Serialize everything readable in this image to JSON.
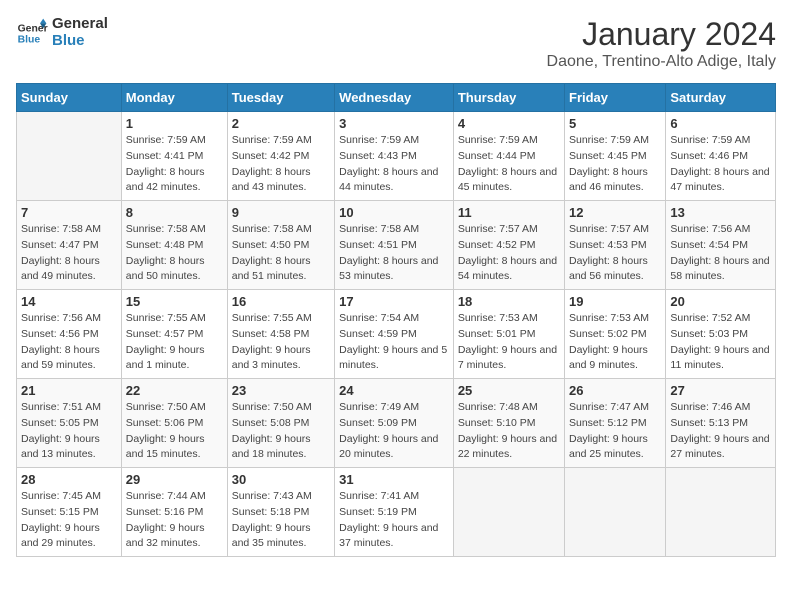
{
  "header": {
    "logo_line1": "General",
    "logo_line2": "Blue",
    "title": "January 2024",
    "subtitle": "Daone, Trentino-Alto Adige, Italy"
  },
  "days_of_week": [
    "Sunday",
    "Monday",
    "Tuesday",
    "Wednesday",
    "Thursday",
    "Friday",
    "Saturday"
  ],
  "weeks": [
    [
      {
        "day": "",
        "sunrise": "",
        "sunset": "",
        "daylight": ""
      },
      {
        "day": "1",
        "sunrise": "7:59 AM",
        "sunset": "4:41 PM",
        "daylight": "8 hours and 42 minutes."
      },
      {
        "day": "2",
        "sunrise": "7:59 AM",
        "sunset": "4:42 PM",
        "daylight": "8 hours and 43 minutes."
      },
      {
        "day": "3",
        "sunrise": "7:59 AM",
        "sunset": "4:43 PM",
        "daylight": "8 hours and 44 minutes."
      },
      {
        "day": "4",
        "sunrise": "7:59 AM",
        "sunset": "4:44 PM",
        "daylight": "8 hours and 45 minutes."
      },
      {
        "day": "5",
        "sunrise": "7:59 AM",
        "sunset": "4:45 PM",
        "daylight": "8 hours and 46 minutes."
      },
      {
        "day": "6",
        "sunrise": "7:59 AM",
        "sunset": "4:46 PM",
        "daylight": "8 hours and 47 minutes."
      }
    ],
    [
      {
        "day": "7",
        "sunrise": "7:58 AM",
        "sunset": "4:47 PM",
        "daylight": "8 hours and 49 minutes."
      },
      {
        "day": "8",
        "sunrise": "7:58 AM",
        "sunset": "4:48 PM",
        "daylight": "8 hours and 50 minutes."
      },
      {
        "day": "9",
        "sunrise": "7:58 AM",
        "sunset": "4:50 PM",
        "daylight": "8 hours and 51 minutes."
      },
      {
        "day": "10",
        "sunrise": "7:58 AM",
        "sunset": "4:51 PM",
        "daylight": "8 hours and 53 minutes."
      },
      {
        "day": "11",
        "sunrise": "7:57 AM",
        "sunset": "4:52 PM",
        "daylight": "8 hours and 54 minutes."
      },
      {
        "day": "12",
        "sunrise": "7:57 AM",
        "sunset": "4:53 PM",
        "daylight": "8 hours and 56 minutes."
      },
      {
        "day": "13",
        "sunrise": "7:56 AM",
        "sunset": "4:54 PM",
        "daylight": "8 hours and 58 minutes."
      }
    ],
    [
      {
        "day": "14",
        "sunrise": "7:56 AM",
        "sunset": "4:56 PM",
        "daylight": "8 hours and 59 minutes."
      },
      {
        "day": "15",
        "sunrise": "7:55 AM",
        "sunset": "4:57 PM",
        "daylight": "9 hours and 1 minute."
      },
      {
        "day": "16",
        "sunrise": "7:55 AM",
        "sunset": "4:58 PM",
        "daylight": "9 hours and 3 minutes."
      },
      {
        "day": "17",
        "sunrise": "7:54 AM",
        "sunset": "4:59 PM",
        "daylight": "9 hours and 5 minutes."
      },
      {
        "day": "18",
        "sunrise": "7:53 AM",
        "sunset": "5:01 PM",
        "daylight": "9 hours and 7 minutes."
      },
      {
        "day": "19",
        "sunrise": "7:53 AM",
        "sunset": "5:02 PM",
        "daylight": "9 hours and 9 minutes."
      },
      {
        "day": "20",
        "sunrise": "7:52 AM",
        "sunset": "5:03 PM",
        "daylight": "9 hours and 11 minutes."
      }
    ],
    [
      {
        "day": "21",
        "sunrise": "7:51 AM",
        "sunset": "5:05 PM",
        "daylight": "9 hours and 13 minutes."
      },
      {
        "day": "22",
        "sunrise": "7:50 AM",
        "sunset": "5:06 PM",
        "daylight": "9 hours and 15 minutes."
      },
      {
        "day": "23",
        "sunrise": "7:50 AM",
        "sunset": "5:08 PM",
        "daylight": "9 hours and 18 minutes."
      },
      {
        "day": "24",
        "sunrise": "7:49 AM",
        "sunset": "5:09 PM",
        "daylight": "9 hours and 20 minutes."
      },
      {
        "day": "25",
        "sunrise": "7:48 AM",
        "sunset": "5:10 PM",
        "daylight": "9 hours and 22 minutes."
      },
      {
        "day": "26",
        "sunrise": "7:47 AM",
        "sunset": "5:12 PM",
        "daylight": "9 hours and 25 minutes."
      },
      {
        "day": "27",
        "sunrise": "7:46 AM",
        "sunset": "5:13 PM",
        "daylight": "9 hours and 27 minutes."
      }
    ],
    [
      {
        "day": "28",
        "sunrise": "7:45 AM",
        "sunset": "5:15 PM",
        "daylight": "9 hours and 29 minutes."
      },
      {
        "day": "29",
        "sunrise": "7:44 AM",
        "sunset": "5:16 PM",
        "daylight": "9 hours and 32 minutes."
      },
      {
        "day": "30",
        "sunrise": "7:43 AM",
        "sunset": "5:18 PM",
        "daylight": "9 hours and 35 minutes."
      },
      {
        "day": "31",
        "sunrise": "7:41 AM",
        "sunset": "5:19 PM",
        "daylight": "9 hours and 37 minutes."
      },
      {
        "day": "",
        "sunrise": "",
        "sunset": "",
        "daylight": ""
      },
      {
        "day": "",
        "sunrise": "",
        "sunset": "",
        "daylight": ""
      },
      {
        "day": "",
        "sunrise": "",
        "sunset": "",
        "daylight": ""
      }
    ]
  ]
}
